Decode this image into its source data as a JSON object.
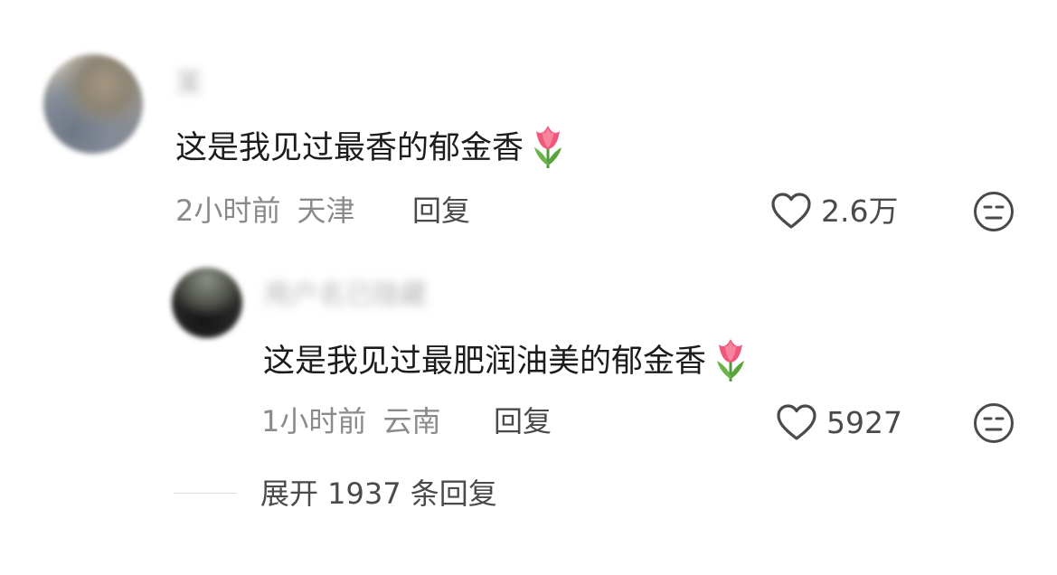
{
  "comments": [
    {
      "username": "某",
      "text": "这是我见过最香的郁金香",
      "emoji": "tulip-emoji",
      "time": "2小时前",
      "location": "天津",
      "reply_label": "回复",
      "likes": "2.6万"
    }
  ],
  "replies": [
    {
      "username": "用户名已隐藏",
      "text": "这是我见过最肥润油美的郁金香",
      "emoji": "tulip-emoji",
      "time": "1小时前",
      "location": "云南",
      "reply_label": "回复",
      "likes": "5927"
    }
  ],
  "expand": {
    "label": "展开 1937 条回复"
  },
  "icons": {
    "like": "heart-outline-icon",
    "dislike": "unamused-face-icon"
  },
  "colors": {
    "text": "#1c1c1c",
    "meta": "#8a8a8a",
    "action": "#4a4a4a"
  }
}
